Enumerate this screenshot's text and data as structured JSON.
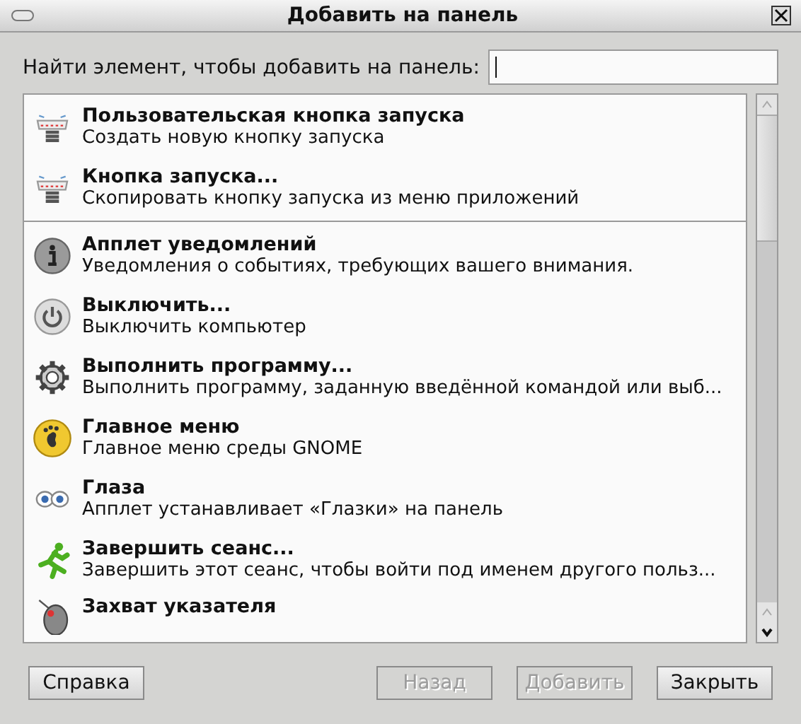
{
  "window": {
    "title": "Добавить на панель"
  },
  "search": {
    "label": "Найти элемент, чтобы добавить на панель:"
  },
  "groups": [
    {
      "items": [
        {
          "title": "Пользовательская кнопка запуска",
          "description": "Создать новую кнопку запуска"
        },
        {
          "title": "Кнопка запуска...",
          "description": "Скопировать кнопку запуска из меню приложений"
        }
      ]
    },
    {
      "items": [
        {
          "title": "Апплет уведомлений",
          "description": "Уведомления о событиях, требующих вашего внимания."
        },
        {
          "title": "Выключить...",
          "description": "Выключить компьютер"
        },
        {
          "title": "Выполнить программу...",
          "description": "Выполнить программу, заданную введённой командой или выб..."
        },
        {
          "title": "Главное меню",
          "description": "Главное меню среды GNOME"
        },
        {
          "title": "Глаза",
          "description": "Апплет устанавливает «Глазки» на панель"
        },
        {
          "title": "Завершить сеанс...",
          "description": "Завершить этот сеанс, чтобы войти под именем другого польз..."
        },
        {
          "title": "Захват указателя"
        }
      ]
    }
  ],
  "buttons": [
    {
      "label": "Справка",
      "disabled": false
    },
    {
      "label": "Назад",
      "disabled": true
    },
    {
      "label": "Добавить",
      "disabled": true
    },
    {
      "label": "Закрыть",
      "disabled": false
    }
  ]
}
